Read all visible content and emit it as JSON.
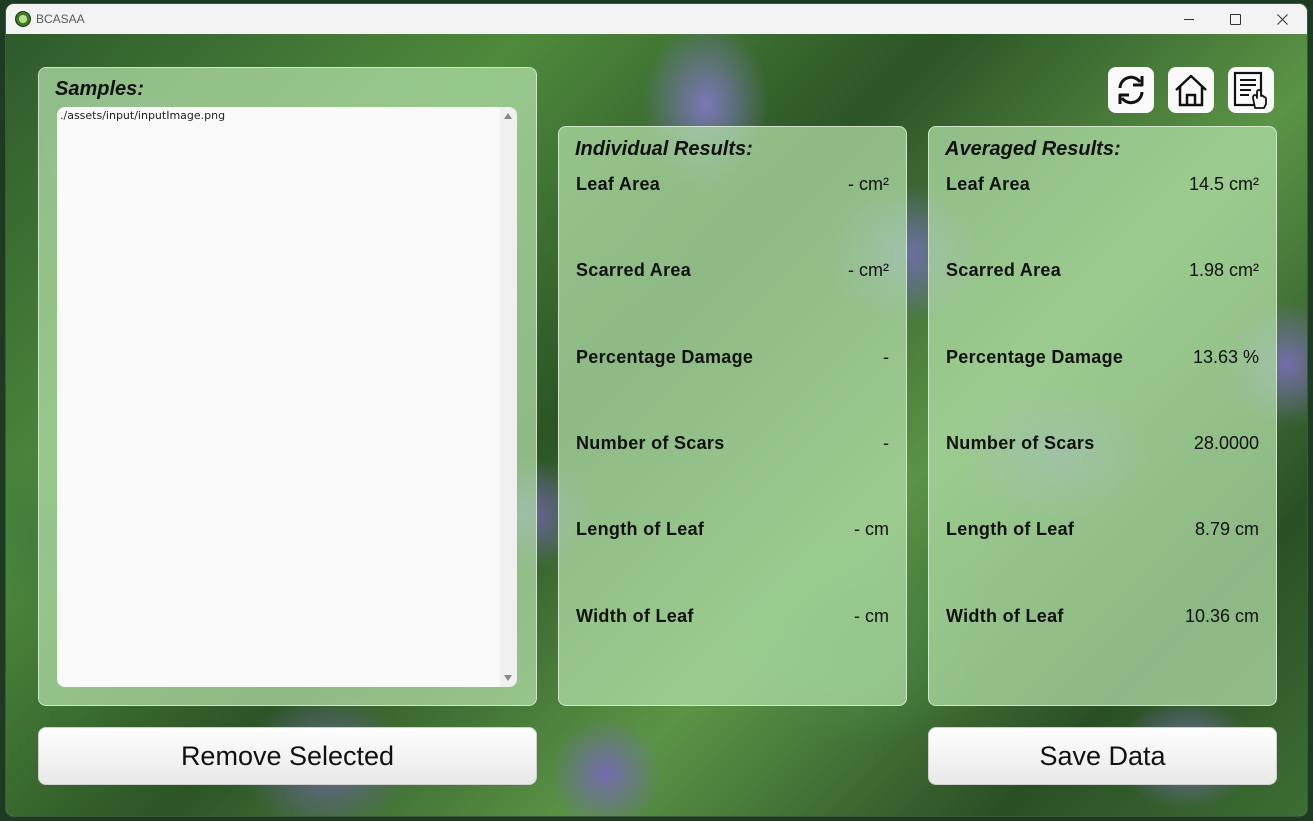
{
  "window": {
    "title": "BCASAA"
  },
  "samples": {
    "heading": "Samples:",
    "items": [
      "./assets/input/inputImage.png"
    ]
  },
  "individual": {
    "heading": "Individual Results:",
    "rows": [
      {
        "label": "Leaf Area",
        "value": "- cm²"
      },
      {
        "label": "Scarred Area",
        "value": "- cm²"
      },
      {
        "label": "Percentage Damage",
        "value": "-"
      },
      {
        "label": "Number of Scars",
        "value": "-"
      },
      {
        "label": "Length of Leaf",
        "value": "- cm"
      },
      {
        "label": "Width of Leaf",
        "value": "- cm"
      }
    ]
  },
  "averaged": {
    "heading": "Averaged Results:",
    "rows": [
      {
        "label": "Leaf Area",
        "value": "14.5 cm²"
      },
      {
        "label": "Scarred Area",
        "value": "1.98 cm²"
      },
      {
        "label": "Percentage Damage",
        "value": "13.63 %"
      },
      {
        "label": "Number of Scars",
        "value": "28.0000"
      },
      {
        "label": "Length of Leaf",
        "value": "8.79 cm"
      },
      {
        "label": "Width of Leaf",
        "value": "10.36 cm"
      }
    ]
  },
  "toolbar": {
    "icons": [
      "refresh-icon",
      "home-icon",
      "report-icon"
    ]
  },
  "buttons": {
    "remove_label": "Remove Selected",
    "save_label": "Save Data"
  },
  "colors": {
    "panel": "#b4e1aa",
    "button": "#fafafa"
  }
}
